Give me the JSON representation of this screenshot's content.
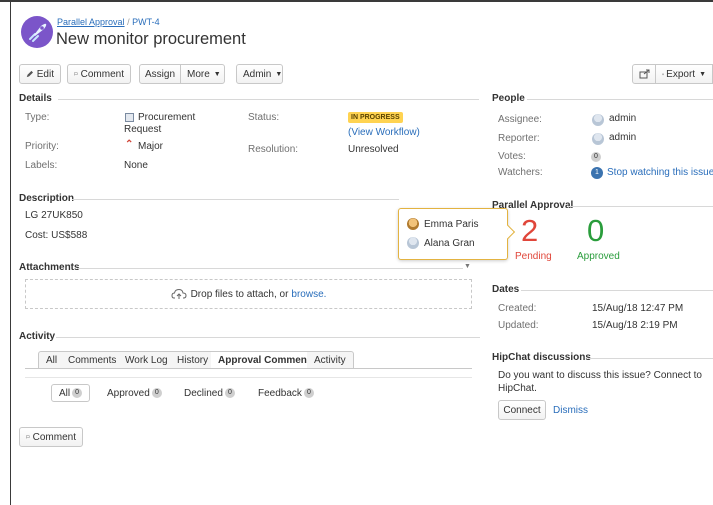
{
  "issue": {
    "breadcrumb_project": "Parallel Approval",
    "breadcrumb_sep": "/",
    "breadcrumb_key": "PWT-4",
    "title": "New monitor procurement"
  },
  "toolbar": {
    "edit": "Edit",
    "comment": "Comment",
    "assign": "Assign",
    "more": "More",
    "admin": "Admin",
    "export": "Export"
  },
  "details": {
    "heading": "Details",
    "type_label": "Type:",
    "type_value_line1": "Procurement",
    "type_value_line2": "Request",
    "priority_label": "Priority:",
    "priority_value": "Major",
    "labels_label": "Labels:",
    "labels_value": "None",
    "status_label": "Status:",
    "status_value": "IN PROGRESS",
    "view_workflow": "(View Workflow)",
    "resolution_label": "Resolution:",
    "resolution_value": "Unresolved"
  },
  "description": {
    "heading": "Description",
    "line1": "LG 27UK850",
    "line2": "Cost: US$588"
  },
  "attachments": {
    "heading": "Attachments",
    "drop_text": "Drop files to attach, or",
    "browse": "browse."
  },
  "activity": {
    "heading": "Activity",
    "tabs": [
      "All",
      "Comments",
      "Work Log",
      "History",
      "Approval Comment",
      "Activity"
    ],
    "filters": [
      {
        "label": "All",
        "count": "0"
      },
      {
        "label": "Approved",
        "count": "0"
      },
      {
        "label": "Declined",
        "count": "0"
      },
      {
        "label": "Feedback",
        "count": "0"
      }
    ],
    "comment_button": "Comment"
  },
  "people": {
    "heading": "People",
    "assignee_label": "Assignee:",
    "assignee_value": "admin",
    "reporter_label": "Reporter:",
    "reporter_value": "admin",
    "votes_label": "Votes:",
    "votes_value": "0",
    "watchers_label": "Watchers:",
    "watchers_count": "1",
    "watchers_link": "Stop watching this issue"
  },
  "parallel_approval": {
    "heading": "Parallel Approval",
    "pending_count": "2",
    "pending_label": "Pending",
    "approved_count": "0",
    "approved_label": "Approved",
    "popup_users": [
      "Emma Paris",
      "Alana Gran"
    ]
  },
  "dates": {
    "heading": "Dates",
    "created_label": "Created:",
    "created_value": "15/Aug/18 12:47 PM",
    "updated_label": "Updated:",
    "updated_value": "15/Aug/18 2:19 PM"
  },
  "hipchat": {
    "heading": "HipChat discussions",
    "text": "Do you want to discuss this issue? Connect to HipChat.",
    "connect": "Connect",
    "dismiss": "Dismiss"
  },
  "colors": {
    "link": "#2a6ebb",
    "status_bg": "#ffd351",
    "pending": "#e0463a",
    "approved": "#2a9d3c",
    "priority": "#d04437"
  },
  "icons": [
    "project-rocket-icon",
    "pencil-icon",
    "speech-bubble-icon",
    "share-icon",
    "export-icon",
    "procurement-type-icon",
    "priority-major-icon",
    "upload-cloud-icon",
    "user-avatar-icon"
  ]
}
